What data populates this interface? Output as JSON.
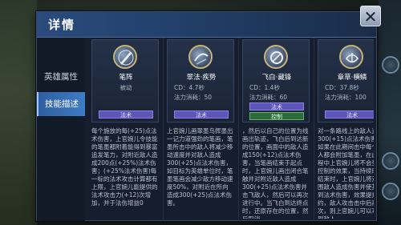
{
  "panel": {
    "title": "详情",
    "close_glyph": "✕"
  },
  "sidebar": {
    "tabs": [
      {
        "label": "英雄属性",
        "active": false
      },
      {
        "label": "技能描述",
        "active": true
      }
    ]
  },
  "skills": [
    {
      "name": "笔阵",
      "type": "被动",
      "line2": "",
      "tag": "法术",
      "tag2": "",
      "description": "每个施放的每(+25)点法术伤害，上官婉儿令技能的笔墨都附着能得到暴富追发笔力，对附近敌人造成200点(+25%)法术伤害；(+25%法术伤害)每一标的法术攻击计算都有上限，上官婉儿能提供的法术攻击力(+12)次增加，并于法伤增益0"
    },
    {
      "name": "翠法·疾势",
      "type": "CD：4.7秒",
      "line2": "法力消耗：50",
      "tag": "法术",
      "tag2": "",
      "description": "上官婉儿画翠墨鸟挥墨出一记力道强劲的笔画，笔墨所击中的敌人将减少移动速度并对敌人造成300(+25)点法术伤害，如目标为英雄单位时，笔墨笔画会减少敌方移动速度50%，对附近在所向造成300(+25)点法术伤害。"
    },
    {
      "name": "飞白·藏锋",
      "type": "CD：1.4秒",
      "line2": "法力消耗：60",
      "tag": "法术",
      "tag2": "控制",
      "description": "，然后以自己的位置为线画出轨迹，飞白后到达新的位置，画面中的敌人造成150(+12)点法术伤害，当笔画结束于起点时，上官婉儿画出闭合笔触并对附近敌人造成300(+25)点法术伤害并击飞敌人，然后可以再次进行中。当飞白到达终点时，还原存在的位置，然后取消"
    },
    {
      "name": "章草·横鳞",
      "type": "CD：37.8秒",
      "line2": "法力消耗：100",
      "tag": "法术",
      "tag2": "",
      "description": "对一条路线上的敌人造成300(+15)点法术伤害，如果在此期间击中每个敌人都会附加笔墨，在此过程中上官婉儿将不会受到控制的效果，当持续时间结束时，上官婉儿将对周围敌人造成伤害并使其受到法术伤害，效果提升约，敌人攻击击中后再次，则上官婉儿可以攻击到敌人。"
    }
  ]
}
